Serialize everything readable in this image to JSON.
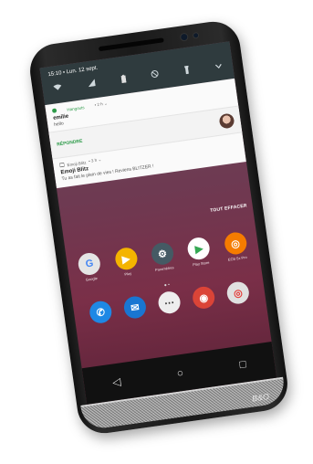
{
  "status": {
    "time_date": "15:10 • Lun. 12 sept."
  },
  "quick_settings": [
    {
      "icon": "wifi-icon"
    },
    {
      "icon": "signal-icon"
    },
    {
      "icon": "battery-icon"
    },
    {
      "icon": "do-not-disturb-icon"
    },
    {
      "icon": "flashlight-icon"
    },
    {
      "icon": "chevron-down-icon"
    }
  ],
  "notifications": [
    {
      "app": "Hangouts",
      "meta": "• 2 h ⌄",
      "title": "emilie",
      "body": "hello",
      "action": "RÉPONDRE"
    },
    {
      "app": "Emoji Blitz",
      "meta": "• 3 h ⌄",
      "title": "Emoji Blitz",
      "body": "Tu as fait le plein de vies ! Reviens BLITZER !"
    }
  ],
  "dismiss_all": "TOUT EFFACER",
  "apps": [
    {
      "label": "Google",
      "icon": "google-folder-icon",
      "glyph": "G",
      "color": "#e5e5e5"
    },
    {
      "label": "Play",
      "icon": "play-folder-icon",
      "glyph": "▶",
      "color": "#f4b400"
    },
    {
      "label": "Paramètres",
      "icon": "settings-icon",
      "glyph": "⚙",
      "color": "#455a64"
    },
    {
      "label": "Play Store",
      "icon": "play-store-icon",
      "glyph": "▶",
      "color": "#ffffff"
    },
    {
      "label": "ECB 5x Pro",
      "icon": "camera-app-icon",
      "glyph": "◎",
      "color": "#f57c00"
    }
  ],
  "dock": [
    {
      "icon": "phone-icon",
      "glyph": "✆",
      "color": "#1e88e5"
    },
    {
      "icon": "messages-icon",
      "glyph": "✉",
      "color": "#1976d2"
    },
    {
      "icon": "app-drawer-icon",
      "glyph": "⋯",
      "color": "#eeeeee"
    },
    {
      "icon": "chrome-icon",
      "glyph": "◉",
      "color": "#db4437"
    },
    {
      "icon": "camera-icon",
      "glyph": "◎",
      "color": "#e0e0e0"
    }
  ],
  "nav": {
    "back": "◁",
    "home": "○",
    "recents": "□"
  },
  "brand": "B&O"
}
